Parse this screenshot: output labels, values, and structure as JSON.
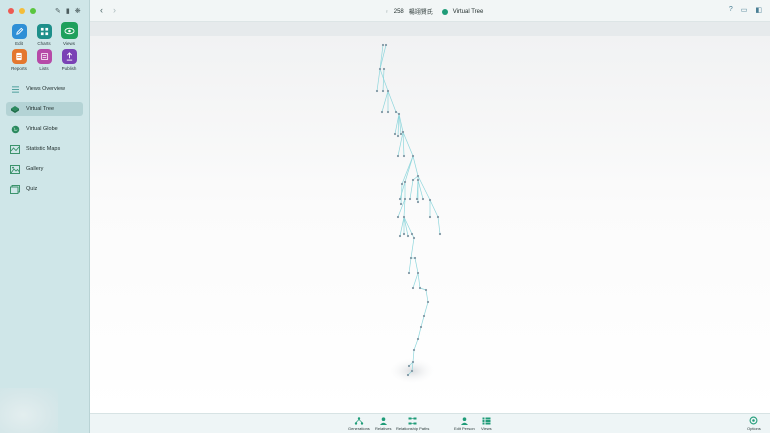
{
  "window": {
    "person_count": "258",
    "person_name": "楊翊賢氏",
    "view_title": "Virtual Tree"
  },
  "apps": [
    {
      "label": "Edit",
      "icon": "pencil-icon",
      "color": "#2f8fd6"
    },
    {
      "label": "Charts",
      "icon": "charts-icon",
      "color": "#1e8f8a"
    },
    {
      "label": "Views",
      "icon": "eye-icon",
      "color": "#1fa05c"
    },
    {
      "label": "Reports",
      "icon": "reports-icon",
      "color": "#e4772e"
    },
    {
      "label": "Lists",
      "icon": "lists-icon",
      "color": "#b64aa8"
    },
    {
      "label": "Publish",
      "icon": "publish-icon",
      "color": "#7a42b5"
    }
  ],
  "nav": [
    {
      "label": "Views Overview",
      "icon": "list-icon",
      "active": false
    },
    {
      "label": "Virtual Tree",
      "icon": "virtual-tree-icon",
      "active": true
    },
    {
      "label": "Virtual Globe",
      "icon": "globe-icon",
      "active": false
    },
    {
      "label": "Statistic Maps",
      "icon": "map-icon",
      "active": false
    },
    {
      "label": "Gallery",
      "icon": "gallery-icon",
      "active": false
    },
    {
      "label": "Quiz",
      "icon": "quiz-icon",
      "active": false
    }
  ],
  "bottom_toolbar": [
    {
      "label": "Generations",
      "icon": "generations-icon"
    },
    {
      "label": "Relatives",
      "icon": "relatives-icon"
    },
    {
      "label": "Relationship Paths",
      "icon": "relationship-paths-icon"
    },
    {
      "label": "Edit Person",
      "icon": "edit-person-icon"
    },
    {
      "label": "Views",
      "icon": "views-icon"
    },
    {
      "label": "Options",
      "icon": "options-icon"
    }
  ],
  "colors": {
    "sidebar_bg": "#cfe6e8",
    "accent": "#1f9c78",
    "tree_line": "#8fd6dc",
    "tree_node": "#7f97a4"
  }
}
